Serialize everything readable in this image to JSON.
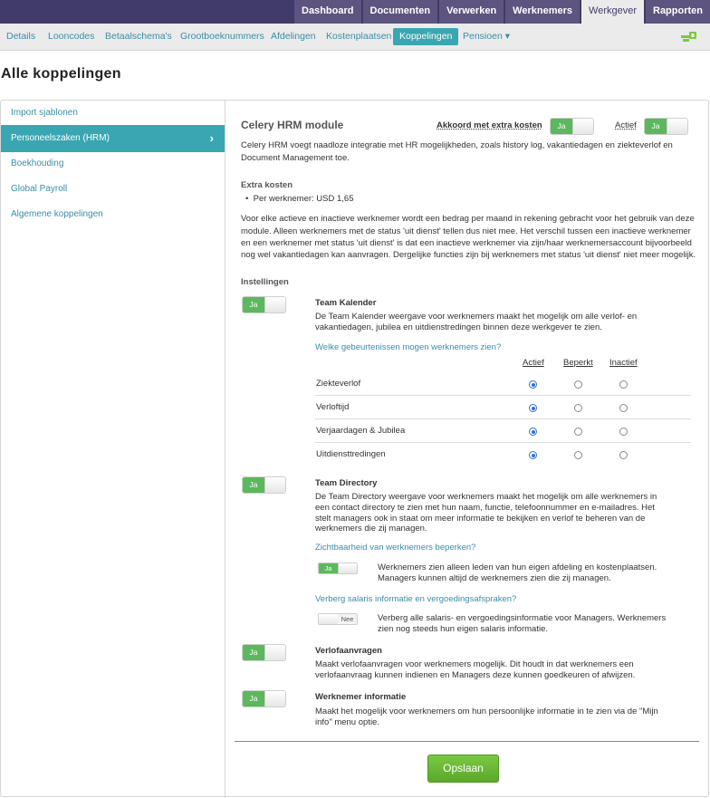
{
  "topnav": [
    "Dashboard",
    "Documenten",
    "Verwerken",
    "Werknemers",
    "Werkgever",
    "Rapporten"
  ],
  "subnav": [
    "Details",
    "Looncodes",
    "Betaalschema's",
    "Grootboeknummers",
    "Afdelingen",
    "Kostenplaatsen",
    "Koppelingen",
    "Pensioen ▾"
  ],
  "page_title": "Alle koppelingen",
  "sidebar": [
    "Import sjablonen",
    "Personeelszaken (HRM)",
    "Boekhouding",
    "Global Payroll",
    "Algemene koppelingen"
  ],
  "module": {
    "title": "Celery HRM module",
    "agree_label": "Akkoord met extra kosten",
    "active_label": "Actief",
    "toggle_on": "Ja",
    "toggle_off": "Nee",
    "intro_1": "Celery HRM voegt naadloze integratie met HR mogelijkheden, zoals history log, vakantiedagen en ziekteverlof en",
    "intro_2": "Document Management toe.",
    "extra_costs_heading": "Extra kosten",
    "extra_costs_item": "Per werknemer: USD 1,65",
    "desc_1": "Voor elke actieve en inactieve werknemer wordt een bedrag per maand in rekening gebracht voor het gebruik van deze",
    "desc_2": "module. Alleen werknemers met de status 'uit dienst' tellen dus niet mee. Het verschil tussen een inactieve werknemer",
    "desc_3": "en een werknemer met status 'uit dienst' is dat een inactieve werknemer via zijn/haar werknemersaccount bijvoorbeeld",
    "desc_4": "nog wel vakantiedagen kan aanvragen. Dergelijke functies zijn bij werknemers met status 'uit dienst' niet meer mogelijk."
  },
  "settings": {
    "heading": "Instellingen",
    "team_kalender": {
      "title": "Team Kalender",
      "desc_1": "De Team Kalender weergave voor werknemers maakt het mogelijk om alle verlof- en",
      "desc_2": "vakantiedagen, jubilea en uitdienstredingen binnen deze werkgever te zien.",
      "question": "Welke gebeurtenissen mogen werknemers zien?",
      "columns": [
        "Actief",
        "Beperkt",
        "Inactief"
      ],
      "rows": [
        "Ziekteverlof",
        "Verloftijd",
        "Verjaardagen & Jubilea",
        "Uitdiensttredingen"
      ]
    },
    "team_directory": {
      "title": "Team Directory",
      "desc_1": "De Team Directory weergave voor werknemers maakt het mogelijk om alle werknemers in",
      "desc_2": "een contact directory te zien met hun naam, functie, telefoonnummer en e-mailadres. Het",
      "desc_3": "stelt managers ook in staat om meer informatie te bekijken en verlof te beheren van de",
      "desc_4": "werknemers die zij managen.",
      "q1": "Zichtbaarheid van werknemers beperken?",
      "q1_desc_1": "Werknemers zien alleen leden van hun eigen afdeling en kostenplaatsen.",
      "q1_desc_2": "Managers kunnen altijd de werknemers zien die zij managen.",
      "q2": "Verberg salaris informatie en vergoedingsafspraken?",
      "q2_desc_1": "Verberg alle salaris- en vergoedingsinformatie voor Managers. Werknemers",
      "q2_desc_2": "zien nog steeds hun eigen salaris informatie."
    },
    "verlof": {
      "title": "Verlofaanvragen",
      "desc_1": "Maakt verlofaanvragen voor werknemers mogelijk. Dit houdt in dat werknemers een",
      "desc_2": "verlofaanvraag kunnen indienen en Managers deze kunnen goedkeuren of afwijzen."
    },
    "werknemer_info": {
      "title": "Werknemer informatie",
      "desc_1": "Maakt het mogelijk voor werknemers om hun persoonlijke informatie in te zien via de \"Mijn",
      "desc_2": "info\" menu optie."
    }
  },
  "save_label": "Opslaan",
  "colors": {
    "topbar": "#413b69",
    "accent": "#3aa6b1",
    "toggle_on": "#5cb85c",
    "save": "#6cb935"
  }
}
